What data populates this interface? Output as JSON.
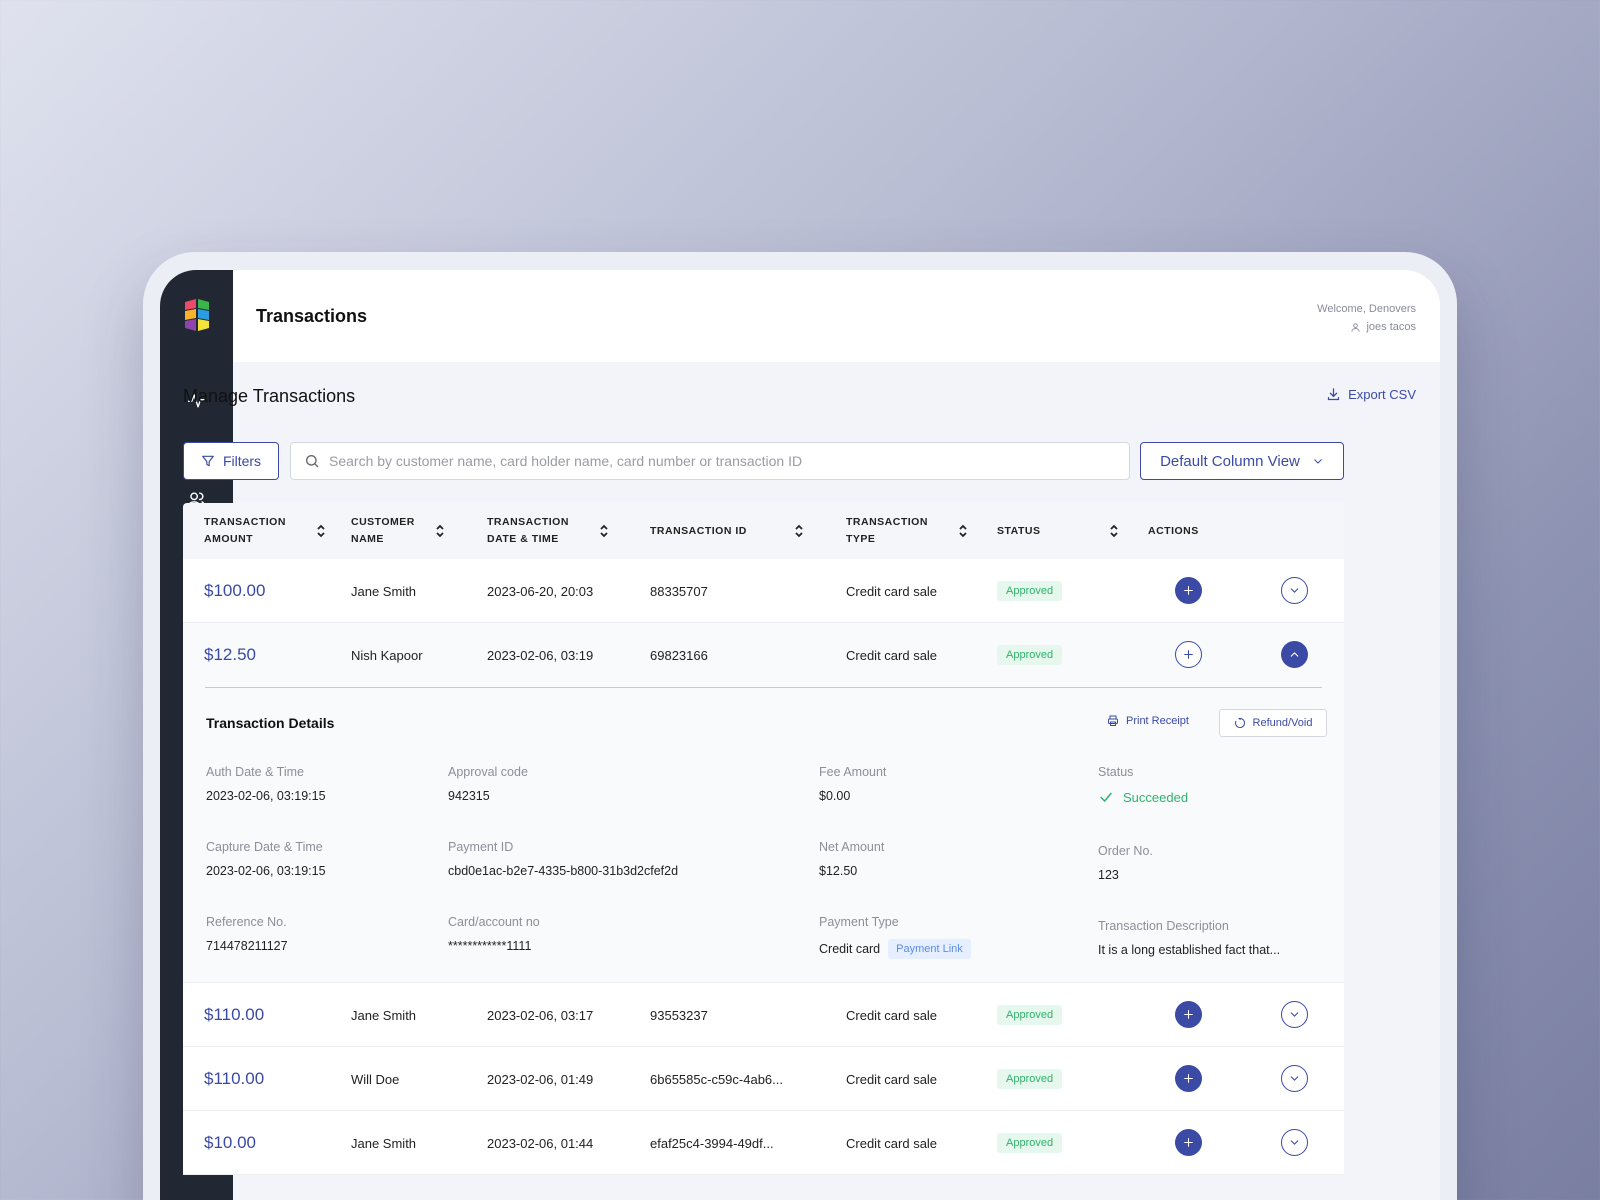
{
  "header": {
    "title": "Transactions",
    "welcome": "Welcome, Denovers",
    "account": "joes tacos"
  },
  "sidebar": {
    "items": [
      {
        "icon": "activity-icon"
      },
      {
        "icon": "card-icon"
      },
      {
        "icon": "users-icon"
      },
      {
        "icon": "list-icon"
      },
      {
        "icon": "clipboard-icon"
      },
      {
        "icon": "book-icon"
      },
      {
        "icon": "crop-icon"
      },
      {
        "icon": "link-icon"
      },
      {
        "icon": "refresh-dollar-icon"
      },
      {
        "icon": "chip-icon"
      },
      {
        "icon": "user-icon"
      },
      {
        "icon": "logout-icon"
      }
    ]
  },
  "main": {
    "section_title": "Manage Transactions",
    "export_label": "Export CSV",
    "filters_label": "Filters",
    "search_placeholder": "Search by customer name, card holder name, card number or transaction ID",
    "view_label": "Default Column View"
  },
  "table": {
    "columns": {
      "amount": "Transaction Amount",
      "customer": "Customer Name",
      "datetime": "Transaction Date & Time",
      "id": "Transaction ID",
      "type": "Transaction Type",
      "status": "Status",
      "actions": "Actions"
    },
    "rows": [
      {
        "amount": "$100.00",
        "customer": "Jane Smith",
        "datetime": "2023-06-20, 20:03",
        "id": "88335707",
        "type": "Credit card sale",
        "status": "Approved"
      },
      {
        "amount": "$12.50",
        "customer": "Nish Kapoor",
        "datetime": "2023-02-06, 03:19",
        "id": "69823166",
        "type": "Credit card sale",
        "status": "Approved"
      },
      {
        "amount": "$110.00",
        "customer": "Jane Smith",
        "datetime": "2023-02-06, 03:17",
        "id": "93553237",
        "type": "Credit card sale",
        "status": "Approved"
      },
      {
        "amount": "$110.00",
        "customer": "Will Doe",
        "datetime": "2023-02-06, 01:49",
        "id": "6b65585c-c59c-4ab6...",
        "type": "Credit card sale",
        "status": "Approved"
      },
      {
        "amount": "$10.00",
        "customer": "Jane Smith",
        "datetime": "2023-02-06, 01:44",
        "id": "efaf25c4-3994-49df...",
        "type": "Credit card sale",
        "status": "Approved"
      }
    ]
  },
  "details": {
    "title": "Transaction Details",
    "print_label": "Print Receipt",
    "refund_label": "Refund/Void",
    "auth_label": "Auth Date & Time",
    "auth_value": "2023-02-06, 03:19:15",
    "approval_label": "Approval code",
    "approval_value": "942315",
    "fee_label": "Fee Amount",
    "fee_value": "$0.00",
    "status_label": "Status",
    "status_value": "Succeeded",
    "capture_label": "Capture Date & Time",
    "capture_value": "2023-02-06, 03:19:15",
    "payment_id_label": "Payment ID",
    "payment_id_value": "cbd0e1ac-b2e7-4335-b800-31b3d2cfef2d",
    "net_label": "Net Amount",
    "net_value": "$12.50",
    "order_label": "Order No.",
    "order_value": "123",
    "reference_label": "Reference No.",
    "reference_value": "714478211127",
    "card_label": "Card/account no",
    "card_value": "************1111",
    "payment_type_label": "Payment Type",
    "payment_type_value": "Credit card",
    "payment_type_badge": "Payment Link",
    "description_label": "Transaction Description",
    "description_value": "It is a long established fact that..."
  },
  "colors": {
    "accent": "#3a4aa5",
    "sidebar": "#222734",
    "success": "#2fb36b",
    "badge_bg": "#e6f7ee"
  }
}
